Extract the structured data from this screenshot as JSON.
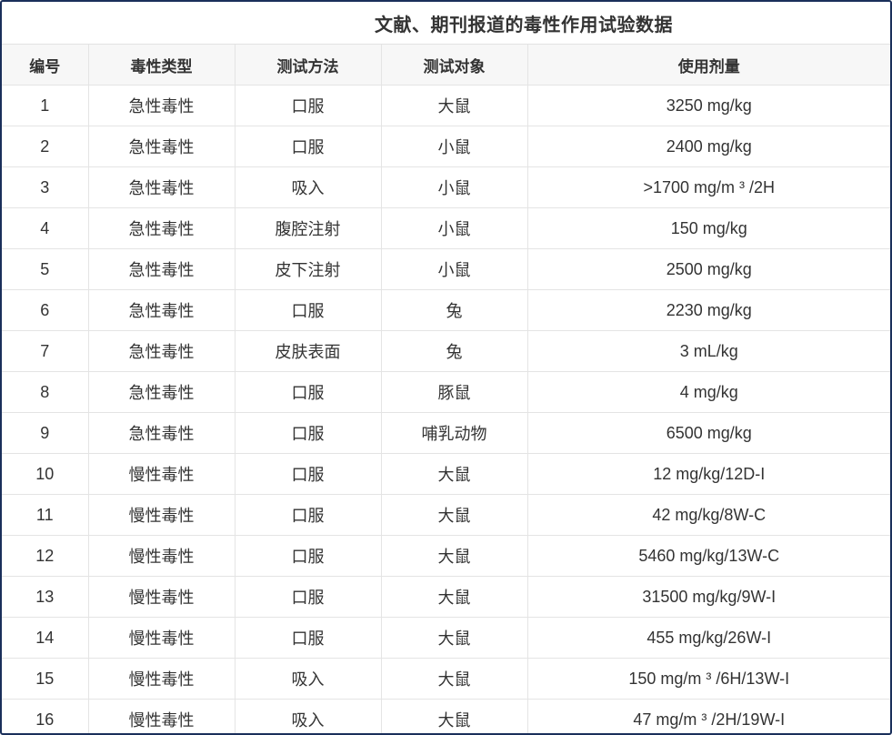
{
  "title": "文献、期刊报道的毒性作用试验数据",
  "headers": [
    "编号",
    "毒性类型",
    "测试方法",
    "测试对象",
    "使用剂量"
  ],
  "rows": [
    {
      "no": "1",
      "type": "急性毒性",
      "method": "口服",
      "subject": "大鼠",
      "dose": "3250 mg/kg"
    },
    {
      "no": "2",
      "type": "急性毒性",
      "method": "口服",
      "subject": "小鼠",
      "dose": "2400 mg/kg"
    },
    {
      "no": "3",
      "type": "急性毒性",
      "method": "吸入",
      "subject": "小鼠",
      "dose": ">1700 mg/m ³ /2H"
    },
    {
      "no": "4",
      "type": "急性毒性",
      "method": "腹腔注射",
      "subject": "小鼠",
      "dose": "150 mg/kg"
    },
    {
      "no": "5",
      "type": "急性毒性",
      "method": "皮下注射",
      "subject": "小鼠",
      "dose": "2500 mg/kg"
    },
    {
      "no": "6",
      "type": "急性毒性",
      "method": "口服",
      "subject": "兔",
      "dose": "2230 mg/kg"
    },
    {
      "no": "7",
      "type": "急性毒性",
      "method": "皮肤表面",
      "subject": "兔",
      "dose": "3 mL/kg"
    },
    {
      "no": "8",
      "type": "急性毒性",
      "method": "口服",
      "subject": "豚鼠",
      "dose": "4 mg/kg"
    },
    {
      "no": "9",
      "type": "急性毒性",
      "method": "口服",
      "subject": "哺乳动物",
      "dose": "6500 mg/kg"
    },
    {
      "no": "10",
      "type": "慢性毒性",
      "method": "口服",
      "subject": "大鼠",
      "dose": "12 mg/kg/12D-I"
    },
    {
      "no": "11",
      "type": "慢性毒性",
      "method": "口服",
      "subject": "大鼠",
      "dose": "42 mg/kg/8W-C"
    },
    {
      "no": "12",
      "type": "慢性毒性",
      "method": "口服",
      "subject": "大鼠",
      "dose": "5460 mg/kg/13W-C"
    },
    {
      "no": "13",
      "type": "慢性毒性",
      "method": "口服",
      "subject": "大鼠",
      "dose": "31500 mg/kg/9W-I"
    },
    {
      "no": "14",
      "type": "慢性毒性",
      "method": "口服",
      "subject": "大鼠",
      "dose": "455 mg/kg/26W-I"
    },
    {
      "no": "15",
      "type": "慢性毒性",
      "method": "吸入",
      "subject": "大鼠",
      "dose": "150 mg/m ³ /6H/13W-I"
    },
    {
      "no": "16",
      "type": "慢性毒性",
      "method": "吸入",
      "subject": "大鼠",
      "dose": "47 mg/m ³ /2H/19W-I"
    }
  ]
}
